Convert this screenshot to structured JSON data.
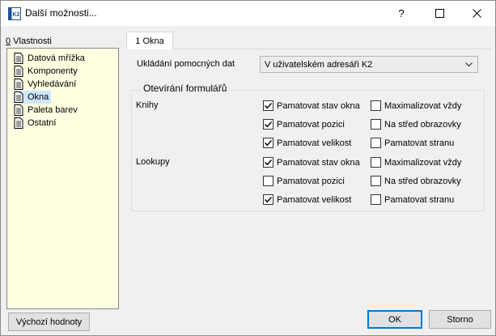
{
  "window": {
    "title": "Další možnosti...",
    "icon_text": "K2",
    "help_glyph": "?"
  },
  "sidebar": {
    "label_prefix": "0",
    "label_rest": " Vlastnosti",
    "items": [
      {
        "label": "Datová mřížka"
      },
      {
        "label": "Komponenty"
      },
      {
        "label": "Vyhledávání"
      },
      {
        "label": "Okna",
        "selected": true
      },
      {
        "label": "Paleta barev"
      },
      {
        "label": "Ostatní"
      }
    ],
    "default_button": "Výchozí hodnoty"
  },
  "tab": {
    "label": "1 Okna"
  },
  "storage": {
    "label": "Ukládání pomocných dat",
    "value": "V uživatelském adresáři K2"
  },
  "group": {
    "title": "Otevírání formulářů",
    "books_label": "Knihy",
    "lookups_label": "Lookupy",
    "books": [
      {
        "label": "Pamatovat stav okna",
        "checked": true
      },
      {
        "label": "Maximalizovat vždy",
        "checked": false
      },
      {
        "label": "Pamatovat pozici",
        "checked": true
      },
      {
        "label": "Na střed obrazovky",
        "checked": false
      },
      {
        "label": "Pamatovat velikost",
        "checked": true
      },
      {
        "label": "Pamatovat stranu",
        "checked": false
      }
    ],
    "lookups": [
      {
        "label": "Pamatovat stav okna",
        "checked": true
      },
      {
        "label": "Maximalizovat vždy",
        "checked": false
      },
      {
        "label": "Pamatovat pozici",
        "checked": false
      },
      {
        "label": "Na střed obrazovky",
        "checked": false
      },
      {
        "label": "Pamatovat velikost",
        "checked": true
      },
      {
        "label": "Pamatovat stranu",
        "checked": false
      }
    ]
  },
  "buttons": {
    "ok": "OK",
    "cancel": "Storno"
  },
  "colors": {
    "accent": "#0078d7",
    "tree_bg": "#ffffe1",
    "selection": "#cce8ff"
  }
}
